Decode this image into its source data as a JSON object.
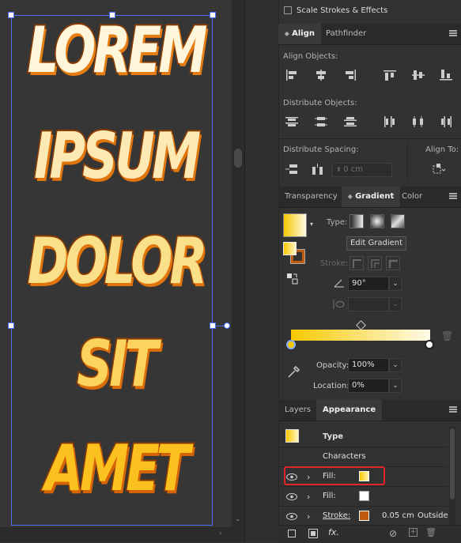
{
  "artboard": {
    "words": [
      "LOREM",
      "IPSUM",
      "DOLOR",
      "SIT",
      "AMET"
    ]
  },
  "scale_strokes": {
    "label": "Scale Strokes & Effects",
    "checked": false
  },
  "align_panel": {
    "tabs": [
      "Align",
      "Pathfinder"
    ],
    "active_tab": "Align",
    "align_objects_label": "Align Objects:",
    "distribute_objects_label": "Distribute Objects:",
    "distribute_spacing_label": "Distribute Spacing:",
    "align_to_label": "Align To:",
    "spacing_value": "0 cm"
  },
  "gradient_panel": {
    "tabs": [
      "Transparency",
      "Gradient",
      "Color"
    ],
    "active_tab": "Gradient",
    "type_label": "Type:",
    "edit_gradient_label": "Edit Gradient",
    "stroke_label": "Stroke:",
    "angle_value": "90°",
    "opacity_label": "Opacity:",
    "opacity_value": "100%",
    "location_label": "Location:",
    "location_value": "0%",
    "gradient_start_color": "#f7c800",
    "gradient_end_color": "#ffffff"
  },
  "appearance_panel": {
    "tabs": [
      "Layers",
      "Appearance"
    ],
    "active_tab": "Appearance",
    "object_type": "Type",
    "characters_label": "Characters",
    "rows": [
      {
        "label": "Fill:",
        "swatch": "#f9d24a",
        "highlighted": true
      },
      {
        "label": "Fill:",
        "swatch": "#ffffff",
        "highlighted": false
      },
      {
        "label": "Stroke:",
        "swatch": "#c25a0e",
        "value": "0.05 cm",
        "align": "Outside",
        "highlighted": false
      }
    ],
    "fx_label": "fx."
  },
  "colors": {
    "highlight_outline": "#e0242a",
    "selection": "#4a6cff"
  }
}
